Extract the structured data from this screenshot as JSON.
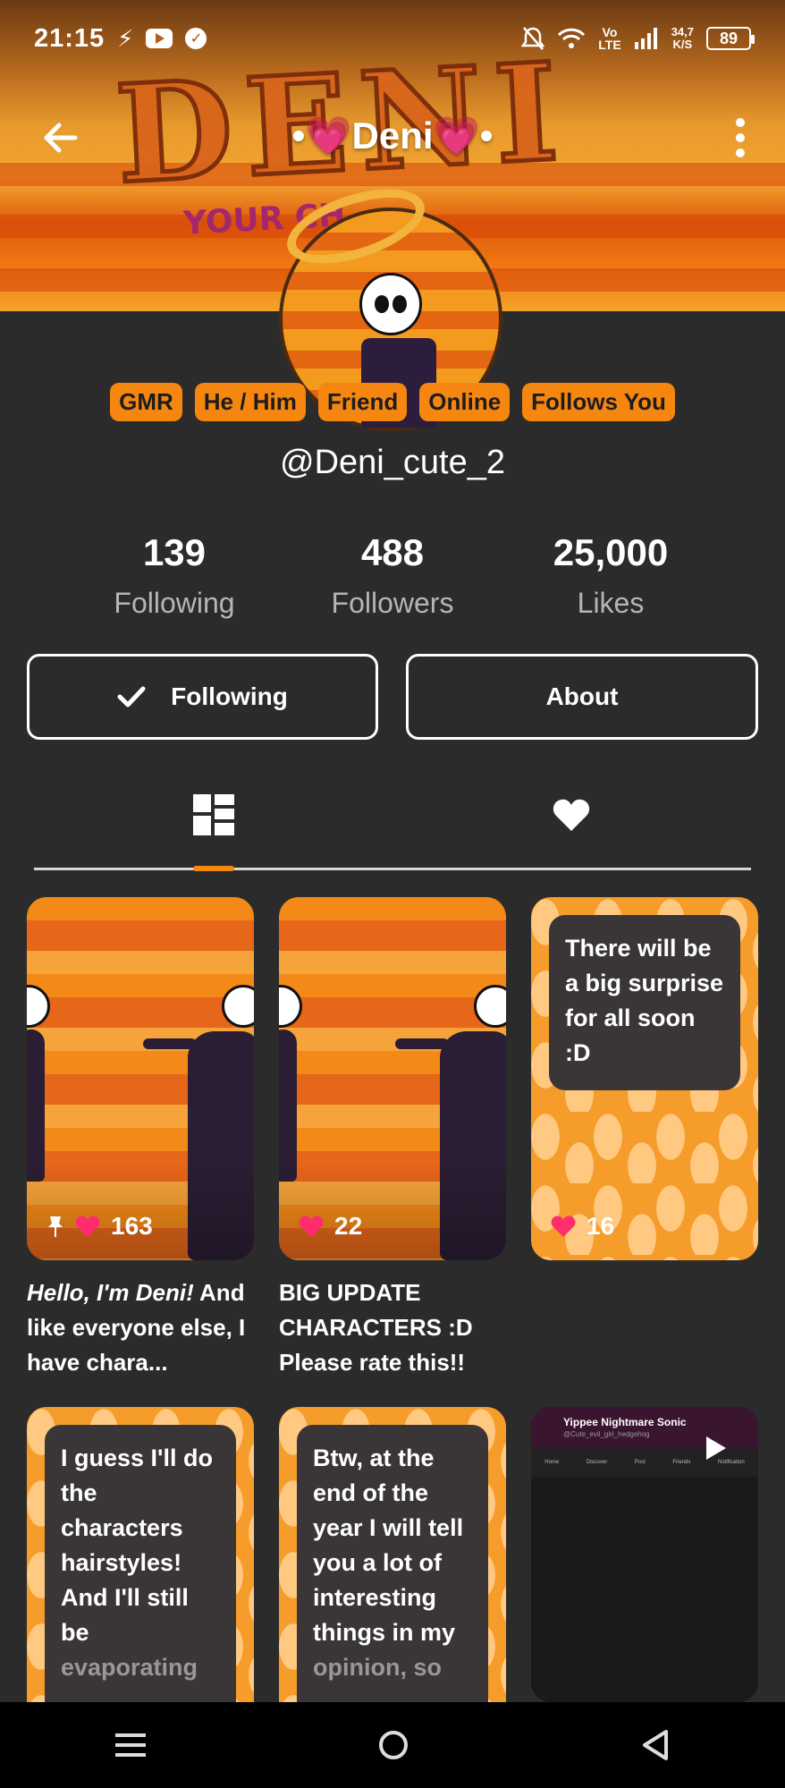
{
  "status_bar": {
    "time": "21:15",
    "volte_top": "Vo",
    "volte_bottom": "LTE",
    "speed_top": "34,7",
    "speed_bottom": "K/S",
    "battery": "89"
  },
  "banner": {
    "art_text": "DENI",
    "art_subtext": "YOUR CH"
  },
  "header": {
    "title": "•💗Deni💗•"
  },
  "profile": {
    "tags": [
      "GMR",
      "He / Him",
      "Friend",
      "Online",
      "Follows You"
    ],
    "handle": "@Deni_cute_2"
  },
  "stats": [
    {
      "value": "139",
      "label": "Following"
    },
    {
      "value": "488",
      "label": "Followers"
    },
    {
      "value": "25,000",
      "label": "Likes"
    }
  ],
  "actions": {
    "following_label": "Following",
    "about_label": "About"
  },
  "tabs": {
    "active": "posts",
    "items": [
      "posts-grid-icon",
      "likes-heart-icon"
    ]
  },
  "posts": [
    {
      "likes": "163",
      "pinned": true,
      "caption_line1": "Hello, I'm Deni!",
      "caption_rest": "And like everyone else, I have chara..."
    },
    {
      "likes": "22",
      "caption": "BIG UPDATE CHARACTERS :D Please rate this!!"
    },
    {
      "likes": "16",
      "text": "There will be a big surprise for all soon :D"
    },
    {
      "text": "I guess I'll do the characters hairstyles! And I'll still be",
      "text_faded": "evaporating"
    },
    {
      "text": "Btw, at the end of the year I will tell you a lot of interesting things in my",
      "text_faded": "opinion, so"
    },
    {
      "thumb_title": "Yippee Nightmare Sonic",
      "thumb_sub": "@Cute_evil_girl_hedgehog",
      "thumb_nav": [
        "Home",
        "Discover",
        "Post",
        "Friends",
        "Notification"
      ]
    }
  ],
  "colors": {
    "accent": "#f5860f",
    "heart": "#ff2d6e",
    "background": "#2b2b2b"
  }
}
